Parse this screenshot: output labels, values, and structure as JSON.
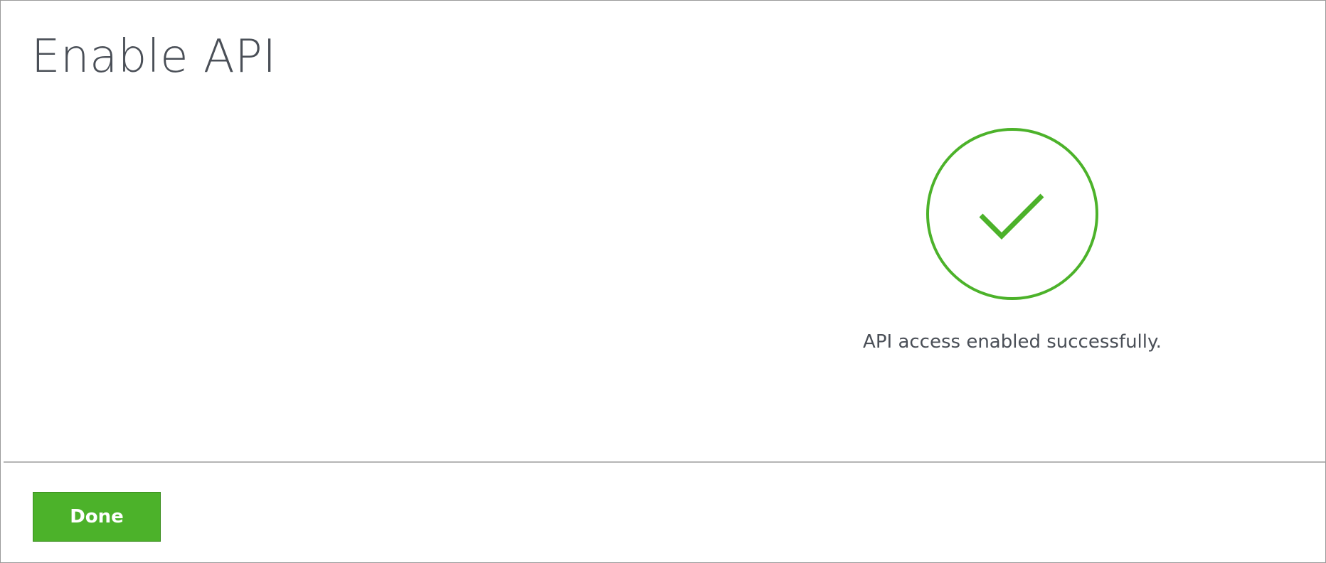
{
  "dialog": {
    "title": "Enable API"
  },
  "status": {
    "icon": "check-circle-icon",
    "message": "API access enabled successfully.",
    "color": "#4cb22a"
  },
  "footer": {
    "done_label": "Done",
    "button_color": "#4cb22a"
  }
}
